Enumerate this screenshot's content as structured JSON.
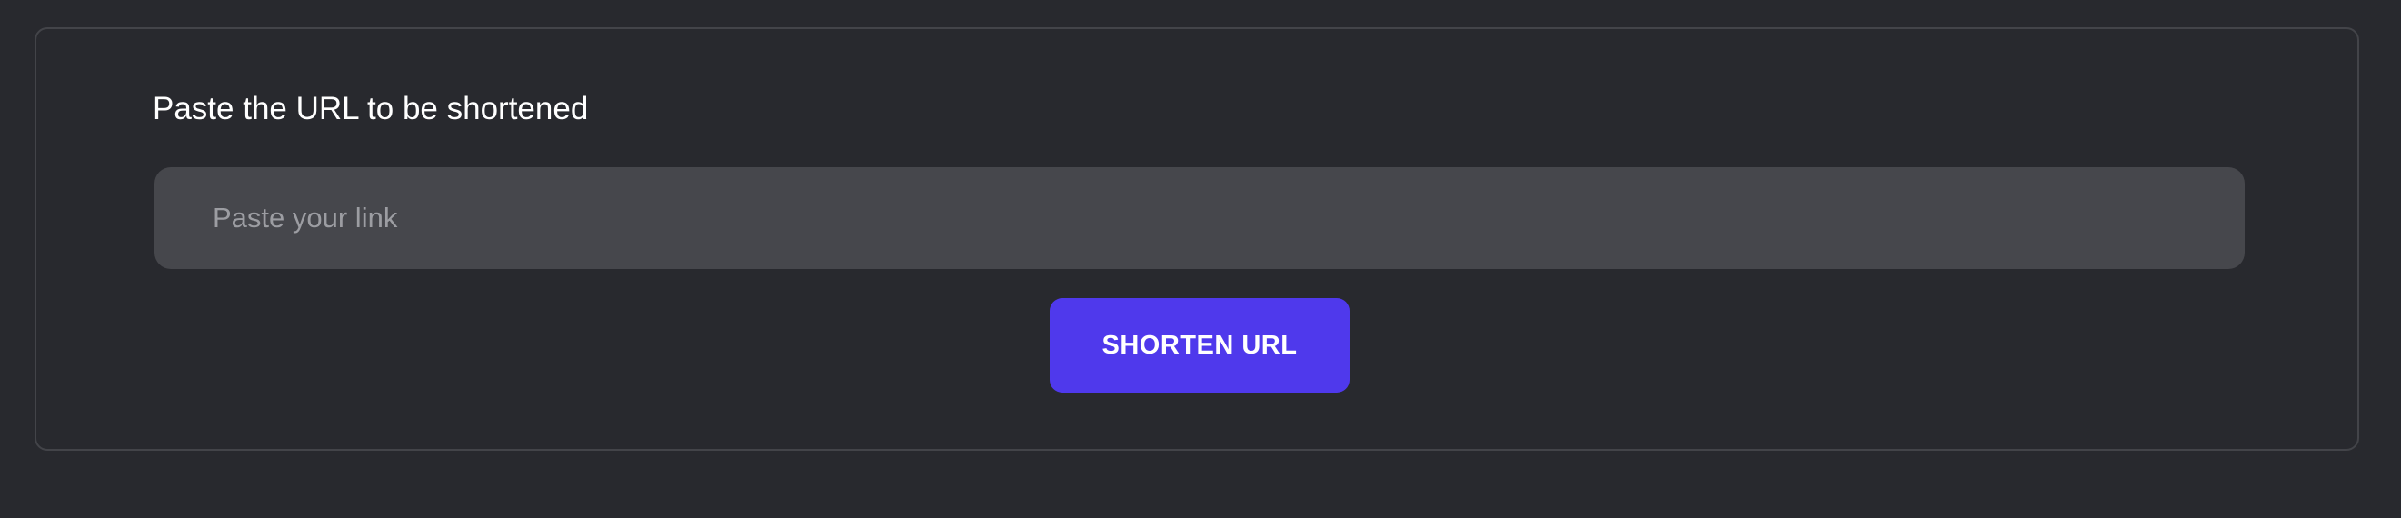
{
  "shortener": {
    "label": "Paste the URL to be shortened",
    "input": {
      "value": "",
      "placeholder": "Paste your link"
    },
    "button_label": "SHORTEN URL"
  },
  "colors": {
    "page_background": "#28292e",
    "card_border": "#434449",
    "input_background": "#46474c",
    "placeholder_text": "#9c9da2",
    "button_background": "#4f39ec",
    "text": "#ffffff"
  }
}
